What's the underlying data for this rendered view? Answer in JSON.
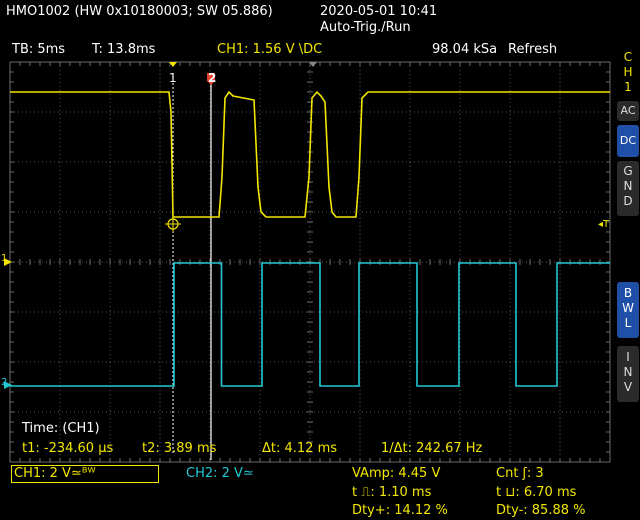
{
  "header": {
    "device": "HMO1002 (HW 0x10180003; SW 05.886)",
    "datetime": "2020-05-01 10:41",
    "mode": "Auto-Trig./Run"
  },
  "infobar": {
    "timebase": "TB: 5ms",
    "trigger_time": "T: 13.8ms",
    "ch1_setting": "CH1: 1.56 V \\DC",
    "sample_rate": "98.04 kSa",
    "acq_mode": "Refresh"
  },
  "side_panel": {
    "channel_label": [
      "C",
      "H",
      "1"
    ],
    "ac": "AC",
    "dc": "DC",
    "gnd": [
      "G",
      "N",
      "D"
    ],
    "bwl": [
      "B",
      "W",
      "L"
    ],
    "inv": [
      "I",
      "N",
      "V"
    ]
  },
  "cursors": {
    "marker1": "1",
    "marker2": "2"
  },
  "markers": {
    "ch1_ground": "1",
    "ch2_ground": "2",
    "trigger_level": "◂T"
  },
  "measurements": {
    "title": "Time: (CH1)",
    "t1": "t1: -234.60 µs",
    "t2": "t2: 3.89 ms",
    "dt": "Δt: 4.12 ms",
    "inv_dt": "1/Δt: 242.67 Hz"
  },
  "footer": {
    "ch1": "CH1: 2 V≃ᴮᵂ",
    "ch2": "CH2: 2 V≃",
    "vamp": "VAmp: 4.45 V",
    "cnt": "Cnt ʃ: 3",
    "t_pos_pulse": "t ⎍: 1.10 ms",
    "t_neg_pulse": "t ⊔: 6.70 ms",
    "duty_pos": "Dty+: 14.12 %",
    "duty_neg": "Dty-: 85.88 %"
  },
  "colors": {
    "ch1": "#f2e600",
    "ch2": "#22c8d4",
    "grid": "#5a5a5a",
    "cursor": "#ffffff",
    "marker2": "#e8412c",
    "panel_active": "#1f4fa6"
  },
  "waveforms": {
    "ch1_edges_ms": [
      -0.3,
      4.8,
      8.9,
      14.2,
      18.5
    ],
    "ch1_levels_div": {
      "high": 3.4,
      "low": 0.9
    },
    "ch2_edges_ms": [
      0.1,
      4.85,
      8.9,
      14.7,
      18.6,
      24.4,
      28.6,
      34.3,
      38.4
    ]
  }
}
